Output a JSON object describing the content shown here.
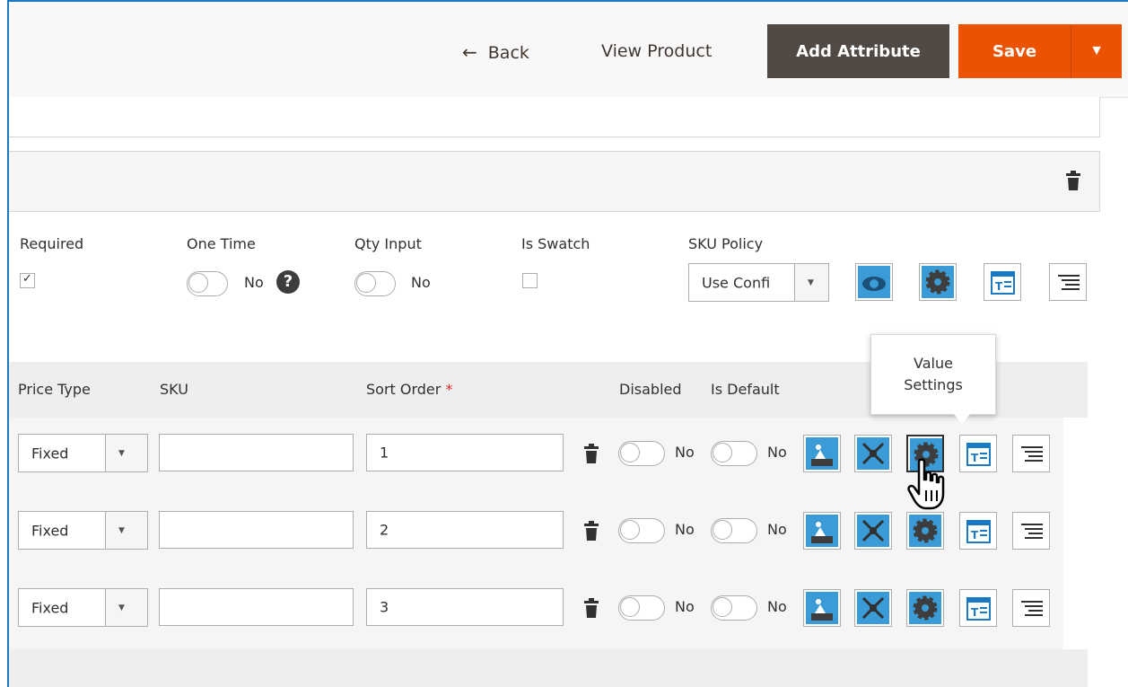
{
  "header": {
    "back_arrow": "←",
    "back_label": "Back",
    "view_product_label": "View Product",
    "add_attribute_label": "Add Attribute",
    "save_label": "Save",
    "save_dropdown_icon": "caret-down-icon"
  },
  "colors": {
    "accent_blue": "#1979c3",
    "save_orange": "#eb5202",
    "dark_button": "#514943",
    "icon_blue": "#3a9bd6"
  },
  "option": {
    "required": {
      "label": "Required",
      "checked": true,
      "mark": "✓"
    },
    "one_time": {
      "label": "One Time",
      "toggle_text": "No",
      "help": "?"
    },
    "qty_input": {
      "label": "Qty Input",
      "toggle_text": "No"
    },
    "is_swatch": {
      "label": "Is Swatch",
      "checked": false
    },
    "sku_policy": {
      "label": "SKU Policy",
      "value": "Use Confi"
    },
    "icons": [
      "eye-icon",
      "gear-icon",
      "template-icon",
      "text-align-icon"
    ]
  },
  "values_table": {
    "columns": {
      "price_type": "Price Type",
      "sku": "SKU",
      "sort_order": "Sort Order",
      "sort_order_required": "*",
      "disabled": "Disabled",
      "is_default": "Is Default"
    },
    "rows": [
      {
        "price_type": "Fixed",
        "sku": "",
        "sort_order": "1",
        "disabled": "No",
        "is_default": "No"
      },
      {
        "price_type": "Fixed",
        "sku": "",
        "sort_order": "2",
        "disabled": "No",
        "is_default": "No"
      },
      {
        "price_type": "Fixed",
        "sku": "",
        "sort_order": "3",
        "disabled": "No",
        "is_default": "No"
      }
    ],
    "row_icons": [
      "image-icon",
      "dependency-icon",
      "gear-icon",
      "template-icon",
      "text-align-icon"
    ]
  },
  "tooltip": {
    "line1": "Value",
    "line2": "Settings"
  }
}
